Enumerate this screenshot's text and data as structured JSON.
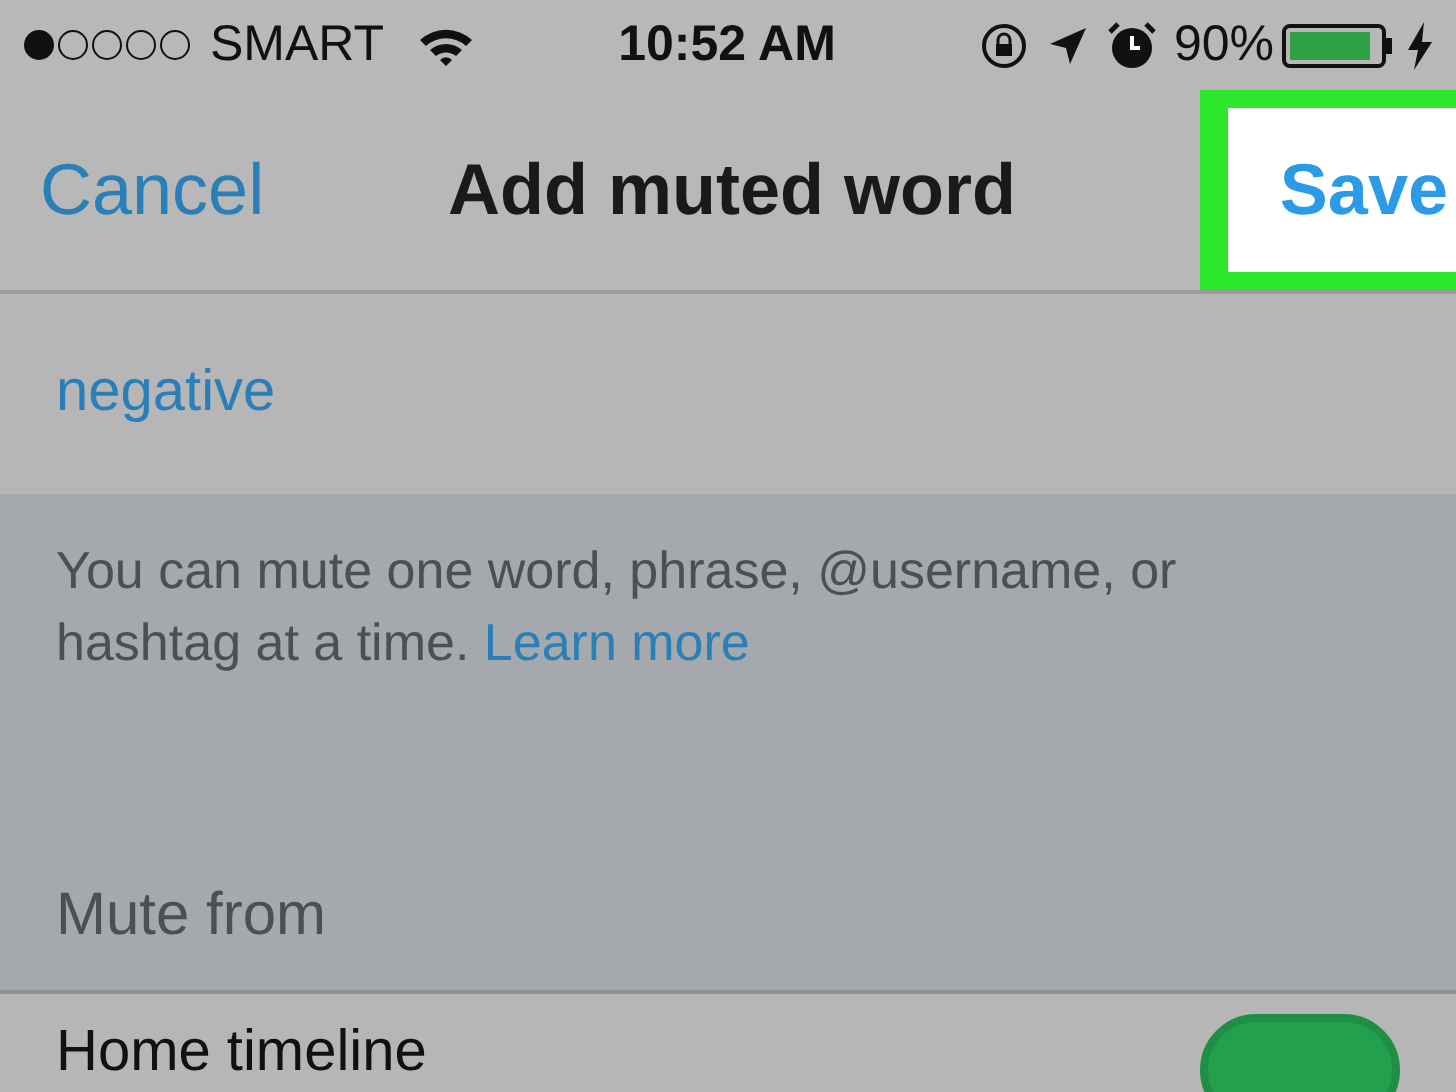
{
  "status_bar": {
    "signal_dots": [
      {
        "filled": true
      },
      {
        "filled": false
      },
      {
        "filled": false
      },
      {
        "filled": false
      },
      {
        "filled": false
      }
    ],
    "carrier": "SMART",
    "time": "10:52 AM",
    "battery": {
      "percent": "90%",
      "level": 0.9
    },
    "charging": true
  },
  "nav": {
    "cancel": "Cancel",
    "title": "Add muted word",
    "save": "Save",
    "save_highlighted": true
  },
  "word_field": {
    "value": "negative"
  },
  "help": {
    "text": "You can mute one word, phrase, @username, or hashtag at a time.",
    "link": "Learn more"
  },
  "section_title": "Mute from",
  "options": [
    {
      "label": "Home timeline",
      "on": true
    }
  ]
}
